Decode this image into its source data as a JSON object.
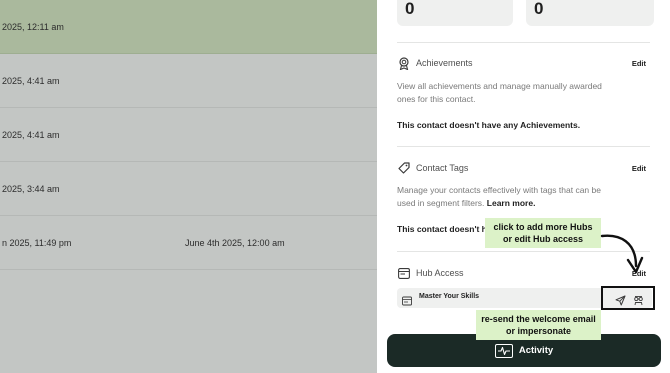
{
  "table": {
    "rows": [
      {
        "col1": "2025, 12:11 am",
        "col2": "",
        "highlight": true
      },
      {
        "col1": "2025, 4:41 am",
        "col2": ""
      },
      {
        "col1": "2025, 4:41 am",
        "col2": ""
      },
      {
        "col1": "2025, 3:44 am",
        "col2": ""
      },
      {
        "col1": "n 2025, 11:49 pm",
        "col2": "June 4th 2025, 12:00 am"
      }
    ]
  },
  "stats": [
    {
      "value": "0"
    },
    {
      "value": "0"
    }
  ],
  "achievements": {
    "title": "Achievements",
    "edit": "Edit",
    "description": "View all achievements and manage manually awarded ones for this contact.",
    "empty": "This contact doesn't have any Achievements."
  },
  "contact_tags": {
    "title": "Contact Tags",
    "edit": "Edit",
    "description": "Manage your contacts effectively with tags that can be used in segment filters.",
    "learn_more": "Learn more.",
    "empty": "This contact doesn't h"
  },
  "hub_access": {
    "title": "Hub Access",
    "edit": "Edit",
    "hub_name": "Master Your Skills"
  },
  "activity_button": {
    "label": "Activity"
  },
  "callouts": {
    "add_hubs": "click to add more Hubs or edit Hub access",
    "resend": "re-send the welcome email or impersonate"
  },
  "icons": {
    "achievements": "badge-icon",
    "tags": "tag-icon",
    "hub": "hub-card-icon",
    "send": "send-icon",
    "impersonate": "impersonate-icon",
    "activity": "activity-pulse-icon"
  }
}
